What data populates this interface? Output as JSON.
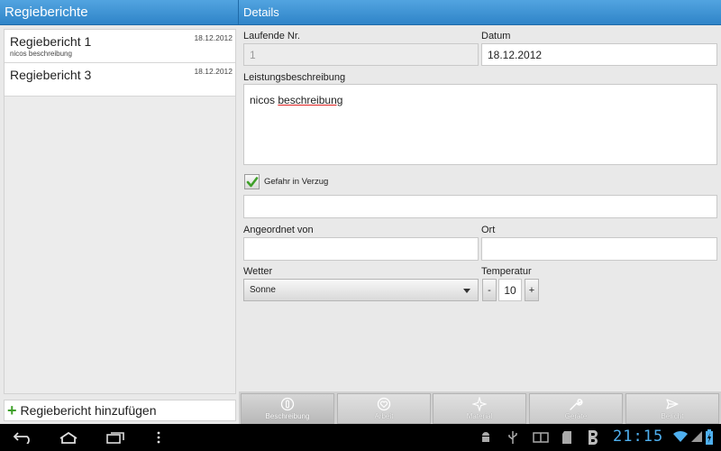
{
  "left_header": {
    "title": "Regieberichte"
  },
  "right_header": {
    "title": "Details"
  },
  "list": {
    "items": [
      {
        "title": "Regiebericht 1",
        "subtitle": "nicos beschreibung",
        "date": "18.12.2012"
      },
      {
        "title": "Regiebericht 3",
        "subtitle": "",
        "date": "18.12.2012"
      }
    ],
    "add_label": "Regiebericht hinzufügen"
  },
  "form": {
    "laufende_nr": {
      "label": "Laufende Nr.",
      "value": "1"
    },
    "datum": {
      "label": "Datum",
      "value": "18.12.2012"
    },
    "leistung": {
      "label": "Leistungsbeschreibung",
      "value_word1": "nicos",
      "value_word2": "beschreibung"
    },
    "gefahr": {
      "label": "Gefahr in Verzug",
      "checked": true,
      "value": ""
    },
    "angeordnet": {
      "label": "Angeordnet von",
      "value": ""
    },
    "ort": {
      "label": "Ort",
      "value": ""
    },
    "wetter": {
      "label": "Wetter",
      "value": "Sonne"
    },
    "temperatur": {
      "label": "Temperatur",
      "minus": "-",
      "value": "10",
      "plus": "+"
    }
  },
  "tabs": [
    {
      "label": "Beschreibung",
      "icon": "circle-info-icon",
      "active": true
    },
    {
      "label": "Arbeit",
      "icon": "heart-circle-icon",
      "active": false
    },
    {
      "label": "Material",
      "icon": "star-icon",
      "active": false
    },
    {
      "label": "Geräte",
      "icon": "wrench-icon",
      "active": false
    },
    {
      "label": "Bericht",
      "icon": "send-icon",
      "active": false
    }
  ],
  "system_bar": {
    "clock": "21:15"
  },
  "colors": {
    "header": "#3a8fd3",
    "accent_clock": "#4fb0ef",
    "checkbox": "#3fa02a"
  }
}
